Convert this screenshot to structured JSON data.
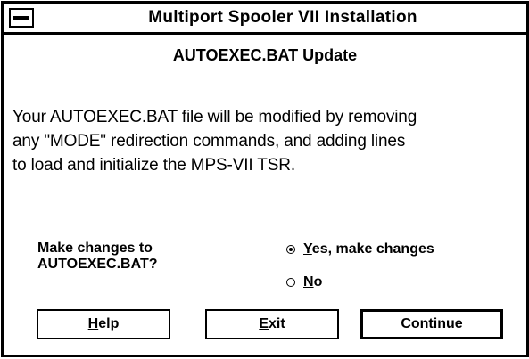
{
  "window": {
    "title": "Multiport Spooler VII Installation"
  },
  "dialog": {
    "heading": "AUTOEXEC.BAT Update",
    "body_line1": "Your AUTOEXEC.BAT file will be modified by removing",
    "body_line2": "any \"MODE\" redirection commands, and adding lines",
    "body_line3": "to load and initialize the MPS-VII TSR.",
    "question_line1": "Make changes to",
    "question_line2": "AUTOEXEC.BAT?"
  },
  "options": {
    "selected": "yes",
    "yes_mnemonic": "Y",
    "yes_rest": "es, make changes",
    "no_mnemonic": "N",
    "no_rest": "o"
  },
  "buttons": {
    "help_mnemonic": "H",
    "help_rest": "elp",
    "exit_mnemonic": "E",
    "exit_rest": "xit",
    "continue_label": "Continue"
  },
  "icons": {
    "system_menu": "system-menu-icon",
    "radio_selected": "radio-selected-icon",
    "radio_unselected": "radio-unselected-icon"
  },
  "colors": {
    "foreground": "#000000",
    "background": "#ffffff"
  }
}
